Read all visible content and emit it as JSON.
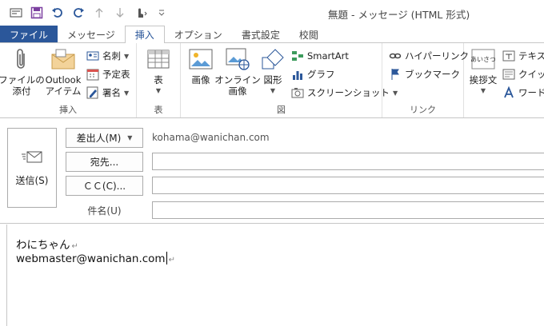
{
  "window": {
    "title": "無題 - メッセージ (HTML 形式)"
  },
  "qat": {
    "icons": [
      "mail-icon",
      "save-icon",
      "undo-icon",
      "redo-icon",
      "up-arrow-icon",
      "down-arrow-icon",
      "touch-mode-icon",
      "customize-icon"
    ]
  },
  "tabs": [
    "ファイル",
    "メッセージ",
    "挿入",
    "オプション",
    "書式設定",
    "校閲"
  ],
  "active_tab": "挿入",
  "ribbon": {
    "insert_group": {
      "label": "挿入",
      "attach_file": "ファイルの\n添付",
      "outlook_item": "Outlook\nアイテム",
      "business_card": "名刺",
      "calendar": "予定表",
      "signature": "署名"
    },
    "table_group": {
      "label": "表",
      "table": "表"
    },
    "illustration_group": {
      "label": "図",
      "pictures": "画像",
      "online_pictures": "オンライン\n画像",
      "shapes": "図形",
      "smartart": "SmartArt",
      "chart": "グラフ",
      "screenshot": "スクリーンショット"
    },
    "link_group": {
      "label": "リンク",
      "hyperlink": "ハイパーリンク",
      "bookmark": "ブックマーク"
    },
    "text_group": {
      "greeting": "挨拶文",
      "textbox": "テキスト",
      "quick": "クイック",
      "wordart": "ワードア"
    }
  },
  "header": {
    "send": "送信(S)",
    "from_button": "差出人(M)",
    "from_value": "kohama@wanichan.com",
    "to_button": "宛先...",
    "cc_button": "ＣＣ(C)...",
    "subject_label": "件名(U)"
  },
  "body": {
    "lines": [
      "わにちゃん",
      "webmaster@wanichan.com"
    ]
  },
  "colors": {
    "accent": "#2b579a",
    "qat_blue": "#2b579a"
  }
}
